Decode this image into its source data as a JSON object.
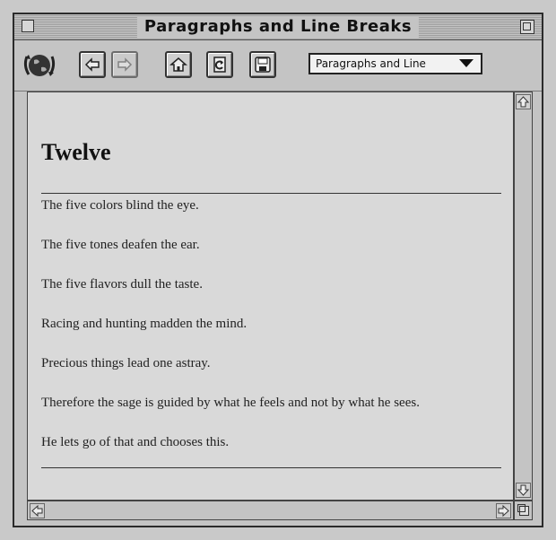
{
  "window": {
    "title": "Paragraphs and Line Breaks"
  },
  "toolbar": {
    "icons": [
      "globe-icon",
      "back-arrow-icon",
      "forward-arrow-icon",
      "home-icon",
      "reload-icon",
      "save-icon"
    ],
    "page_select": {
      "value": "Paragraphs and Line"
    }
  },
  "page": {
    "heading": "Twelve",
    "lines": [
      "The five colors blind the eye.",
      "The five tones deafen the ear.",
      "The five flavors dull the taste.",
      "Racing and hunting madden the mind.",
      "Precious things lead one astray.",
      "Therefore the sage is guided by what he feels and not by what he sees.",
      "He lets go of that and chooses this."
    ]
  }
}
